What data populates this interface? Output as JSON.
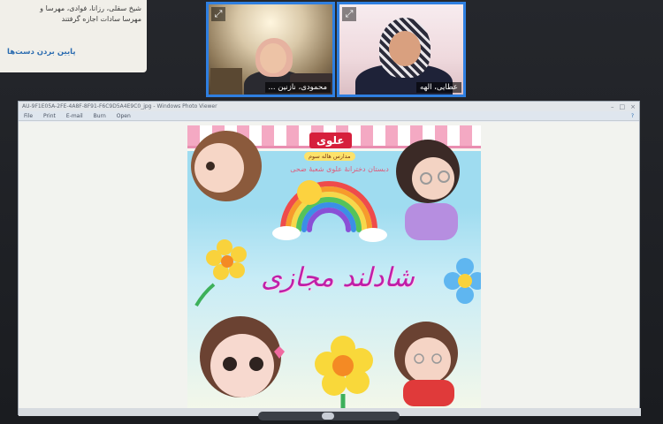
{
  "chat": {
    "line1": "شیخ سقلی، رزانا، فوادی، مهرسا و",
    "line2": "مهرسا سادات اجازه گرفتند",
    "action": "پایین بردن دست‌ها"
  },
  "tiles": [
    {
      "name": "محمودی، نازنین ...",
      "icon": "expand-icon"
    },
    {
      "name": "عطایی، الهه",
      "icon": "expand-icon"
    }
  ],
  "viewer": {
    "title": "AU-9F1E05A-2FE-4A8F-8F91-F6C9D5A4E9C0_jpg - Windows Photo Viewer",
    "menu": [
      "File",
      "Print",
      "E-mail",
      "Burn",
      "Open"
    ],
    "help": "?"
  },
  "poster": {
    "brand": "علوی",
    "brand_sub": "مدارس هاله سوم",
    "tagline": "دبستان دخترانهٔ علوی شعبهٔ ضحی",
    "headline": "شادلند مجازی"
  },
  "colors": {
    "tile_border": "#2f7fe0",
    "brand": "#d61f3c",
    "headline": "#c01fa8",
    "awning_pink": "#f4a9c3"
  }
}
